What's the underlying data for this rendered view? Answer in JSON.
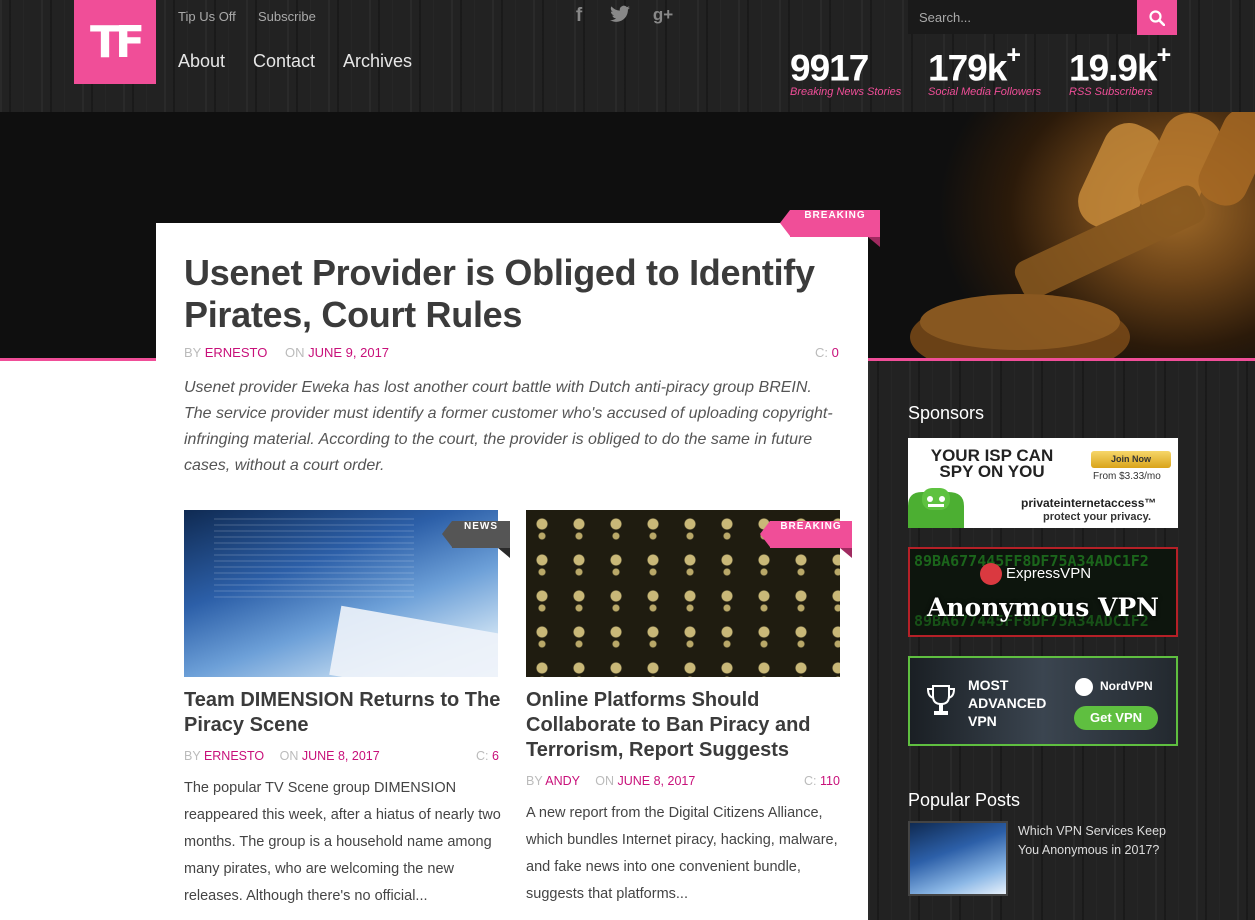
{
  "header": {
    "logo_text": "TF",
    "top_links": [
      "Tip Us Off",
      "Subscribe"
    ],
    "social_icons": [
      "facebook-icon",
      "twitter-icon",
      "google-plus-icon"
    ],
    "search_placeholder": "Search...",
    "nav": [
      "About",
      "Contact",
      "Archives"
    ],
    "stats": [
      {
        "value": "9917",
        "suffix": "",
        "label": "Breaking News Stories"
      },
      {
        "value": "179k",
        "suffix": "+",
        "label": "Social Media Followers"
      },
      {
        "value": "19.9k",
        "suffix": "+",
        "label": "RSS Subscribers"
      }
    ]
  },
  "featured": {
    "tag": "BREAKING",
    "title": "Usenet Provider is Obliged to Identify Pirates, Court Rules",
    "by_label": "BY",
    "author": "ERNESTO",
    "on_label": "ON",
    "date": "JUNE 9, 2017",
    "comments_label": "C:",
    "comments": "0",
    "excerpt": "Usenet provider Eweka has lost another court battle with Dutch anti-piracy group BREIN. The service provider must identify a former customer who's accused of uploading copyright-infringing material. According to the court, the provider is obliged to do the same in future cases, without a court order."
  },
  "articles": [
    {
      "tag": "NEWS",
      "title": "Team DIMENSION Returns to The Piracy Scene",
      "by_label": "BY",
      "author": "ERNESTO",
      "on_label": "ON",
      "date": "JUNE 8, 2017",
      "comments_label": "C:",
      "comments": "6",
      "excerpt": "The popular TV Scene group DIMENSION reappeared this week, after a hiatus of nearly two months. The group is a household name among many pirates, who are welcoming the new releases. Although there's no official..."
    },
    {
      "tag": "BREAKING",
      "title": "Online Platforms Should Collaborate to Ban Piracy and Terrorism, Report Suggests",
      "by_label": "BY",
      "author": "ANDY",
      "on_label": "ON",
      "date": "JUNE 8, 2017",
      "comments_label": "C:",
      "comments": "110",
      "excerpt": "A new report from the Digital Citizens Alliance, which bundles Internet piracy, hacking, malware, and fake news into one convenient bundle, suggests that platforms..."
    }
  ],
  "sidebar": {
    "sponsors_title": "Sponsors",
    "ads": [
      {
        "headline": "YOUR ISP CAN SPY ON YOU",
        "button": "Join Now",
        "price": "From $3.33/mo",
        "brand": "privateinternetaccess™",
        "tagline": "protect your privacy."
      },
      {
        "brand": "ExpressVPN",
        "headline": "Anonymous VPN",
        "hex_text": "89BA677445FF8DF75A34ADC1F2"
      },
      {
        "headline": "MOST ADVANCED VPN",
        "brand": "NordVPN",
        "button": "Get VPN"
      }
    ],
    "popular_title": "Popular Posts",
    "popular": [
      {
        "title": "Which VPN Services Keep You Anonymous in 2017?"
      }
    ]
  },
  "colors": {
    "accent": "#f04e98",
    "accent_dark": "#c8107a"
  }
}
